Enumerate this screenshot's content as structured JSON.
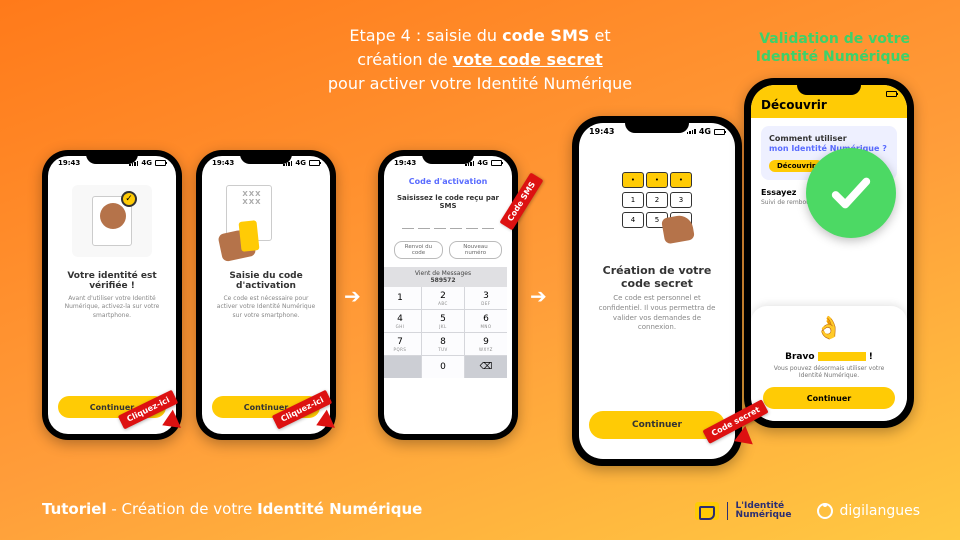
{
  "title": {
    "line1_pre": "Etape 4 : saisie du ",
    "line1_bold": "code SMS",
    "line1_post": " et",
    "line2_pre": "création de ",
    "line2_bold_u": "vote code secret",
    "line3": "pour activer votre Identité Numérique"
  },
  "validation": {
    "l1": "Validation de votre",
    "l2": "Identité Numérique"
  },
  "footer": {
    "tutoriel": "Tutoriel",
    "sep": "  -  ",
    "rest": "Création de votre ",
    "bold": "Identité Numérique"
  },
  "logos": {
    "identite": "L'Identité\nNumérique",
    "digi": "digilangues"
  },
  "status": {
    "time": "19:43",
    "net": "4G"
  },
  "phones": {
    "p1": {
      "h": "Votre identité est vérifiée !",
      "p": "Avant d'utiliser votre Identité Numérique, activez-la sur votre smartphone.",
      "btn": "Continuer"
    },
    "p2": {
      "h": "Saisie du code d'activation",
      "p": "Ce code est nécessaire pour activer votre Identité Numérique sur votre smartphone.",
      "btn": "Continuer",
      "dots": "XXX XXX"
    },
    "p3": {
      "hd": "Code d'activation",
      "lab": "Saisissez le code reçu par SMS",
      "lk1": "Renvoi du code",
      "lk2": "Nouveau numéro",
      "sugg_l": "Vient de Messages",
      "sugg_n": "589572",
      "keys": [
        [
          "1",
          ""
        ],
        [
          "2",
          "ABC"
        ],
        [
          "3",
          "DEF"
        ],
        [
          "4",
          "GHI"
        ],
        [
          "5",
          "JKL"
        ],
        [
          "6",
          "MNO"
        ],
        [
          "7",
          "PQRS"
        ],
        [
          "8",
          "TUV"
        ],
        [
          "9",
          "WXYZ"
        ],
        [
          "",
          ""
        ],
        [
          "0",
          ""
        ],
        [
          "⌫",
          ""
        ]
      ]
    },
    "p4": {
      "h": "Création de votre code secret",
      "p": "Ce code est personnel et confidentiel. Il vous permettra de valider vos demandes de connexion.",
      "btn": "Continuer"
    },
    "p5": {
      "discover": "Découvrir",
      "q1": "Comment utiliser",
      "q2": "mon Identité Numérique ?",
      "db": "Découvrir",
      "t2": "Essayez",
      "t2p": "Suivi de remboursement d'assurance…",
      "bh_pre": "Bravo ",
      "bh_post": " !",
      "bp": "Vous pouvez désormais utiliser votre Identité Numérique.",
      "bbtn": "Continuer"
    }
  },
  "tags": {
    "click": "Cliquez-ici",
    "sms": "Code SMS",
    "secret": "Code secret"
  },
  "arrows": {
    "glyph": "➔"
  }
}
